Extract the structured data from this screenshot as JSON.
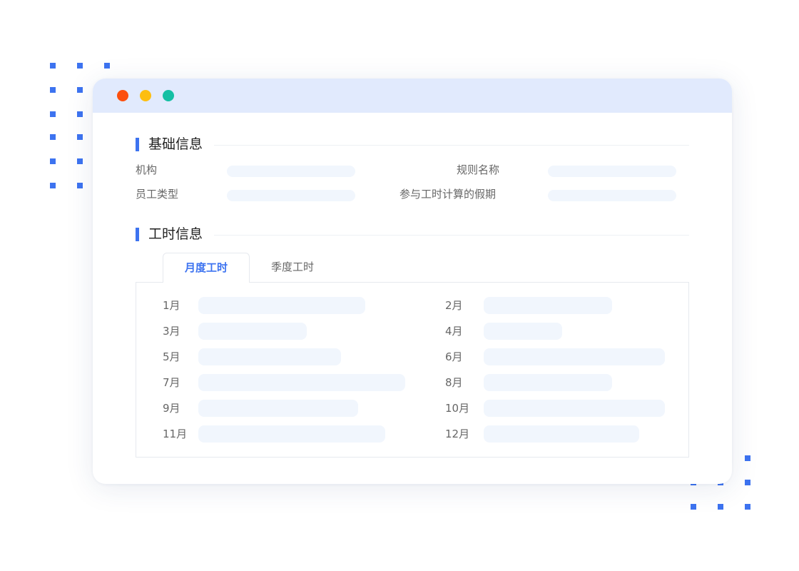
{
  "window": {
    "controls": [
      "close",
      "minimize",
      "maximize"
    ]
  },
  "basic_info": {
    "title": "基础信息",
    "fields": [
      {
        "label": "机构"
      },
      {
        "label": "规则名称"
      },
      {
        "label": "员工类型"
      },
      {
        "label": "参与工时计算的假期"
      }
    ]
  },
  "work_hours": {
    "title": "工时信息",
    "tabs": [
      {
        "label": "月度工时",
        "active": true
      },
      {
        "label": "季度工时",
        "active": false
      }
    ],
    "months": [
      {
        "label": "1月"
      },
      {
        "label": "2月"
      },
      {
        "label": "3月"
      },
      {
        "label": "4月"
      },
      {
        "label": "5月"
      },
      {
        "label": "6月"
      },
      {
        "label": "7月"
      },
      {
        "label": "8月"
      },
      {
        "label": "9月"
      },
      {
        "label": "10月"
      },
      {
        "label": "11月"
      },
      {
        "label": "12月"
      }
    ]
  },
  "colors": {
    "accent": "#3d73f0",
    "titlebar": "#e1eafd",
    "placeholder": "#f1f6fd",
    "close": "#fc4f0e",
    "minimize": "#fdbe10",
    "maximize": "#14bfa4"
  }
}
